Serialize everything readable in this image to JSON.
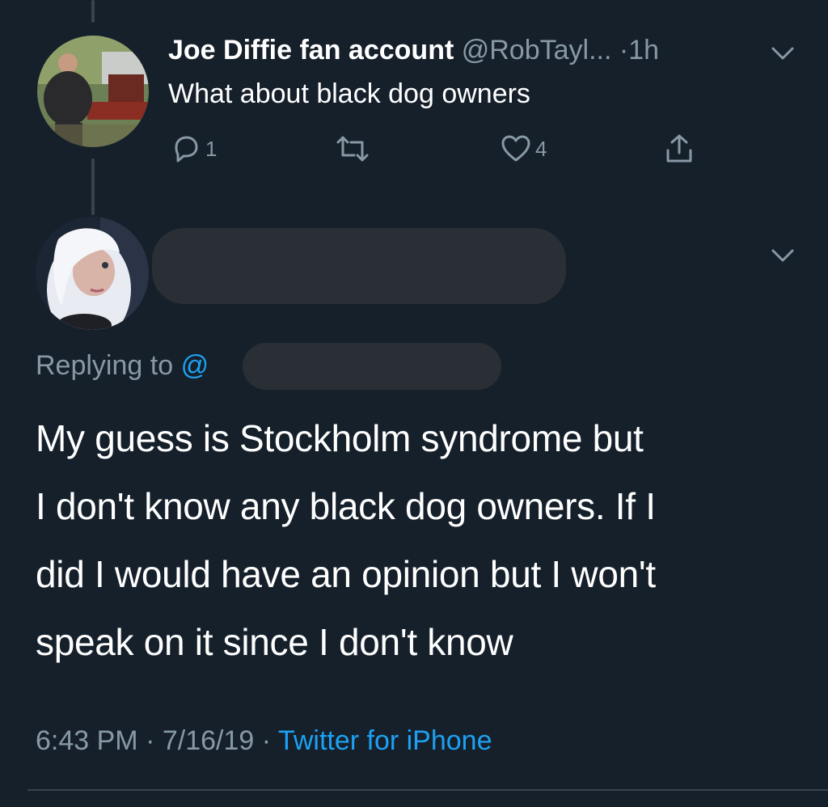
{
  "parent_tweet": {
    "display_name": "Joe Diffie fan account",
    "handle": "@RobTayl...",
    "separator": "·",
    "time_ago": "1h",
    "text": "What about black dog owners",
    "actions": {
      "reply_count": "1",
      "retweet_count": "",
      "like_count": "4"
    }
  },
  "focused_tweet": {
    "replying_prefix": "Replying to",
    "replying_at": "@",
    "text_lines": [
      "My guess is Stockholm syndrome but",
      "I don't know any black dog owners. If I",
      "did I would have an opinion but I won't",
      "speak on it since I don't know"
    ],
    "time": "6:43 PM",
    "separator_1": "·",
    "date": "7/16/19",
    "separator_2": "·",
    "source": "Twitter for iPhone"
  },
  "icons": {
    "reply": "reply-icon",
    "retweet": "retweet-icon",
    "like": "heart-icon",
    "share": "share-icon",
    "more": "chevron-down-icon"
  },
  "colors": {
    "background": "#15202b",
    "text_primary": "#ffffff",
    "text_secondary": "#8899a6",
    "link": "#1da1f2",
    "thread_line": "#38444d",
    "redaction": "#2a2f35"
  }
}
